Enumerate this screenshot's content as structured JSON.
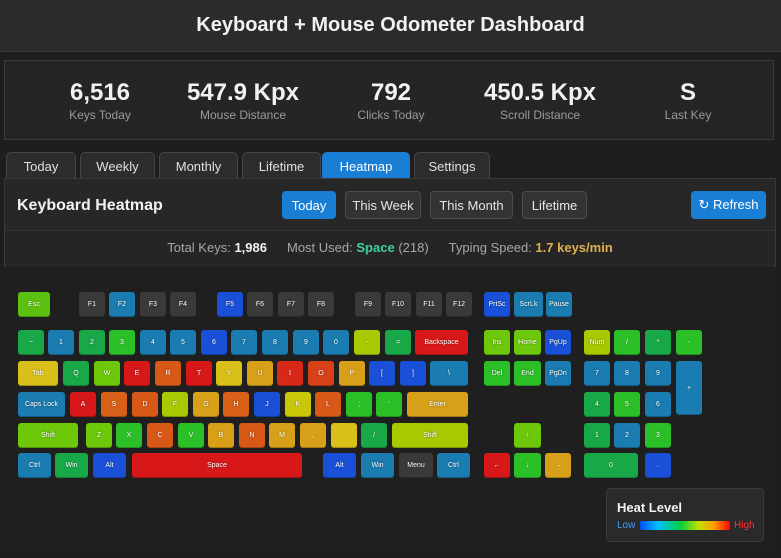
{
  "app": {
    "title": "Keyboard + Mouse Odometer Dashboard"
  },
  "stats": [
    {
      "value": "6,516",
      "label": "Keys Today"
    },
    {
      "value": "547.9 Kpx",
      "label": "Mouse Distance"
    },
    {
      "value": "792",
      "label": "Clicks Today"
    },
    {
      "value": "450.5 Kpx",
      "label": "Scroll Distance"
    },
    {
      "value": "S",
      "label": "Last Key"
    }
  ],
  "tabs": [
    "Today",
    "Weekly",
    "Monthly",
    "Lifetime",
    "Heatmap",
    "Settings"
  ],
  "active_tab": "Heatmap",
  "panel": {
    "title": "Keyboard Heatmap",
    "ranges": [
      "Today",
      "This Week",
      "This Month",
      "Lifetime"
    ],
    "active_range": "Today",
    "refresh_label": "↻ Refresh"
  },
  "summary": {
    "total_label": "Total Keys:",
    "total_value": "1,986",
    "most_label": "Most Used:",
    "most_value": "Space",
    "most_count": "(218)",
    "speed_label": "Typing Speed:",
    "speed_value": "1.7 keys/min"
  },
  "legend": {
    "title": "Heat Level",
    "low": "Low",
    "high": "High"
  },
  "colors": {
    "accent": "#1a7fd4",
    "heat_low": "#0050ff",
    "heat_high": "#ff0000"
  },
  "keyboard": {
    "keys": [
      [
        "Esc",
        "#5cc010"
      ],
      [
        "F1",
        "#3a3a3a"
      ],
      [
        "F2",
        "#1a7cb0"
      ],
      [
        "F3",
        "#3a3a3a"
      ],
      [
        "F4",
        "#3a3a3a"
      ],
      [
        "F5",
        "#1a50d8"
      ],
      [
        "F6",
        "#3a3a3a"
      ],
      [
        "F7",
        "#3a3a3a"
      ],
      [
        "F8",
        "#3a3a3a"
      ],
      [
        "F9",
        "#3a3a3a"
      ],
      [
        "F10",
        "#3a3a3a"
      ],
      [
        "F11",
        "#3a3a3a"
      ],
      [
        "F12",
        "#3a3a3a"
      ],
      [
        "PrtSc",
        "#1a50d8"
      ],
      [
        "ScrLk",
        "#1a7cb0"
      ],
      [
        "Pause",
        "#1a7cb0"
      ],
      [
        "~",
        "#18a848"
      ],
      [
        "1",
        "#1a7cb0"
      ],
      [
        "2",
        "#18a848"
      ],
      [
        "3",
        "#2cc028"
      ],
      [
        "4",
        "#1a7cb0"
      ],
      [
        "5",
        "#1a7cb0"
      ],
      [
        "6",
        "#1a50d8"
      ],
      [
        "7",
        "#1a7cb0"
      ],
      [
        "8",
        "#1a7cb0"
      ],
      [
        "9",
        "#1a7cb0"
      ],
      [
        "0",
        "#1a7cb0"
      ],
      [
        "-",
        "#a8c800"
      ],
      [
        "=",
        "#18a848"
      ],
      [
        "Backspace",
        "#d81818"
      ],
      [
        "Ins",
        "#6cc808"
      ],
      [
        "Home",
        "#6cc808"
      ],
      [
        "PgUp",
        "#1a50d8"
      ],
      [
        "Num",
        "#a8c800"
      ],
      [
        "/",
        "#2cc028"
      ],
      [
        "*",
        "#18a848"
      ],
      [
        "-",
        "#2cc028"
      ],
      [
        "Tab",
        "#d8c018"
      ],
      [
        "Q",
        "#18a848"
      ],
      [
        "W",
        "#6cc808"
      ],
      [
        "E",
        "#d81818"
      ],
      [
        "R",
        "#d85818"
      ],
      [
        "T",
        "#d81818"
      ],
      [
        "Y",
        "#d8c018"
      ],
      [
        "U",
        "#d8a018"
      ],
      [
        "I",
        "#d82818"
      ],
      [
        "O",
        "#d84018"
      ],
      [
        "P",
        "#d8a018"
      ],
      [
        "[",
        "#1a50d8"
      ],
      [
        "]",
        "#1a50d8"
      ],
      [
        "\\",
        "#1a7cb0"
      ],
      [
        "Del",
        "#2cc028"
      ],
      [
        "End",
        "#2cc028"
      ],
      [
        "PgDn",
        "#1a7cb0"
      ],
      [
        "7",
        "#1a7cb0"
      ],
      [
        "8",
        "#1a7cb0"
      ],
      [
        "9",
        "#1a7cb0"
      ],
      [
        "+",
        "#1a7cb0"
      ],
      [
        "Caps Lock",
        "#1a7cb0"
      ],
      [
        "A",
        "#d81818"
      ],
      [
        "S",
        "#d86018"
      ],
      [
        "D",
        "#d85818"
      ],
      [
        "F",
        "#a8c800"
      ],
      [
        "G",
        "#d8a018"
      ],
      [
        "H",
        "#d86018"
      ],
      [
        "J",
        "#1a50d8"
      ],
      [
        "K",
        "#c8c808"
      ],
      [
        "L",
        "#d85818"
      ],
      [
        ";",
        "#2cc028"
      ],
      [
        "'",
        "#2cc028"
      ],
      [
        "Enter",
        "#d8a018"
      ],
      [
        "4",
        "#18a848"
      ],
      [
        "5",
        "#2cc028"
      ],
      [
        "6",
        "#1a7cb0"
      ],
      [
        "Shift",
        "#6cc808"
      ],
      [
        "Z",
        "#6cc808"
      ],
      [
        "X",
        "#2cc028"
      ],
      [
        "C",
        "#d85818"
      ],
      [
        "V",
        "#2cc028"
      ],
      [
        "B",
        "#d8a018"
      ],
      [
        "N",
        "#d85818"
      ],
      [
        "M",
        "#d8a018"
      ],
      [
        ",",
        "#d8a018"
      ],
      [
        ".",
        "#d8c018"
      ],
      [
        "/",
        "#18a848"
      ],
      [
        "Shift",
        "#a8c800"
      ],
      [
        "↑",
        "#6cc808"
      ],
      [
        "1",
        "#18a848"
      ],
      [
        "2",
        "#1a7cb0"
      ],
      [
        "3",
        "#2cc028"
      ],
      [
        "Ctrl",
        "#1a7cb0"
      ],
      [
        "Win",
        "#18a848"
      ],
      [
        "Alt",
        "#1a50d8"
      ],
      [
        "Space",
        "#d81818"
      ],
      [
        "Alt",
        "#1a50d8"
      ],
      [
        "Win",
        "#1a7cb0"
      ],
      [
        "Menu",
        "#3a3a3a"
      ],
      [
        "Ctrl",
        "#1a7cb0"
      ],
      [
        "←",
        "#d81818"
      ],
      [
        "↓",
        "#2cc028"
      ],
      [
        "→",
        "#d8a018"
      ],
      [
        "0",
        "#18a848"
      ],
      [
        ".",
        "#1a50d8"
      ]
    ]
  }
}
